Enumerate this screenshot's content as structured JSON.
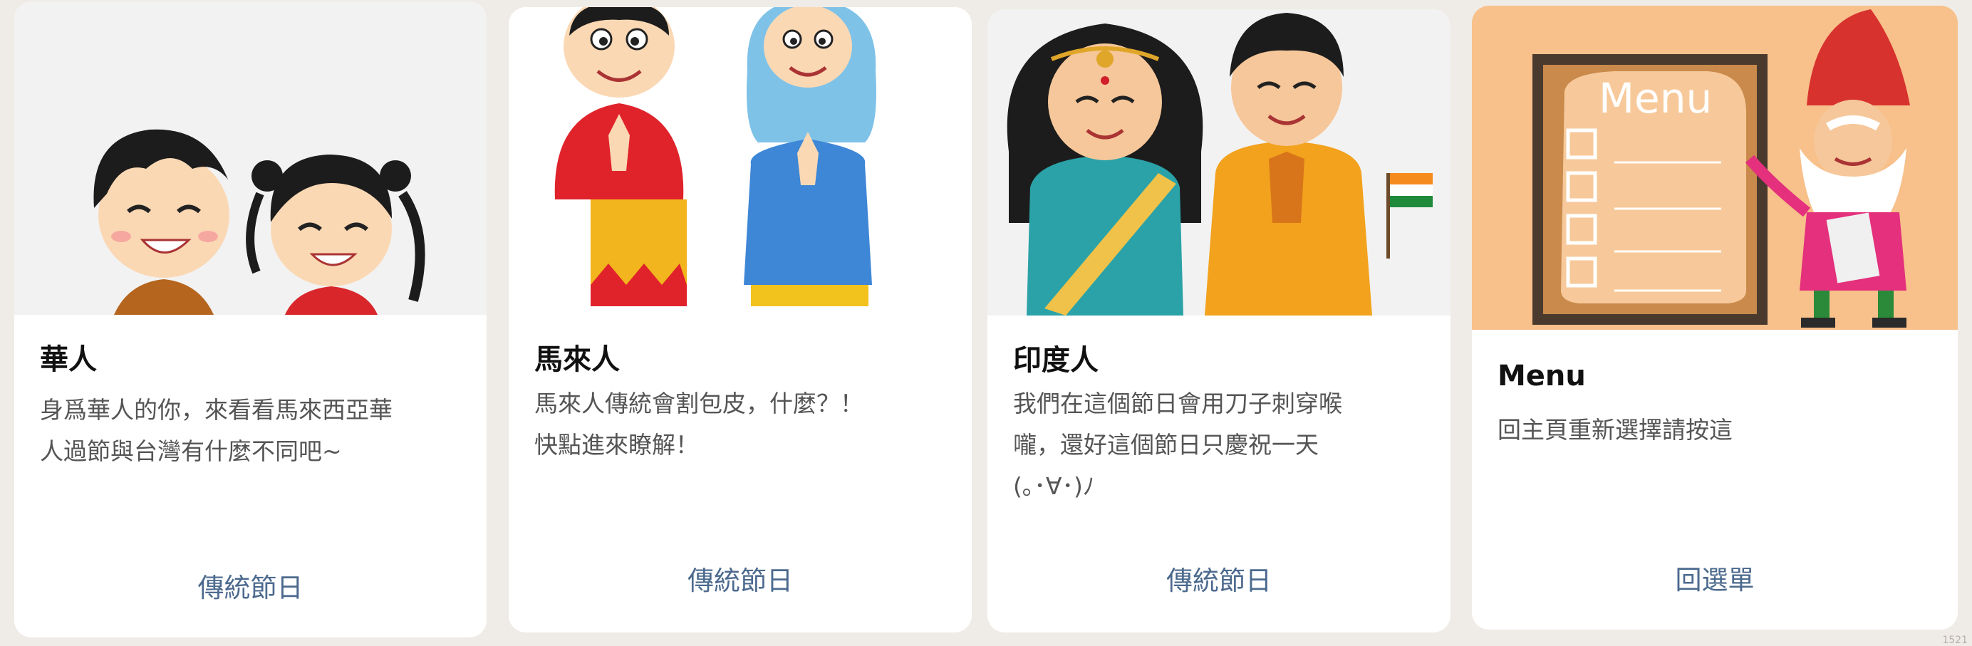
{
  "cards": [
    {
      "title": "華人",
      "description_lines": [
        "身爲華人的你，來看看馬來西亞華",
        "人過節與台灣有什麼不同吧~"
      ],
      "action_label": "傳統節日",
      "image": "chinese-children-illustration"
    },
    {
      "title": "馬來人",
      "description_lines": [
        "馬來人傳統會割包皮，什麼？！",
        "快點進來瞭解！"
      ],
      "action_label": "傳統節日",
      "image": "malay-couple-illustration"
    },
    {
      "title": "印度人",
      "description_lines": [
        "我們在這個節日會用刀子刺穿喉",
        "嚨，還好這個節日只慶祝一天",
        "(｡･∀･)ﾉ"
      ],
      "action_label": "傳統節日",
      "image": "indian-couple-illustration"
    },
    {
      "title": "Menu",
      "description_lines": [
        "回主頁重新選擇請按這"
      ],
      "action_label": "回選單",
      "image": "chef-with-menu-board-illustration"
    }
  ],
  "corner_text": "1521",
  "colors": {
    "background": "#efebe6",
    "card": "#ffffff",
    "action_link": "#4c6a8e",
    "title": "#111111",
    "description": "#555555",
    "menu_hero_bg": "#f8c08a"
  }
}
